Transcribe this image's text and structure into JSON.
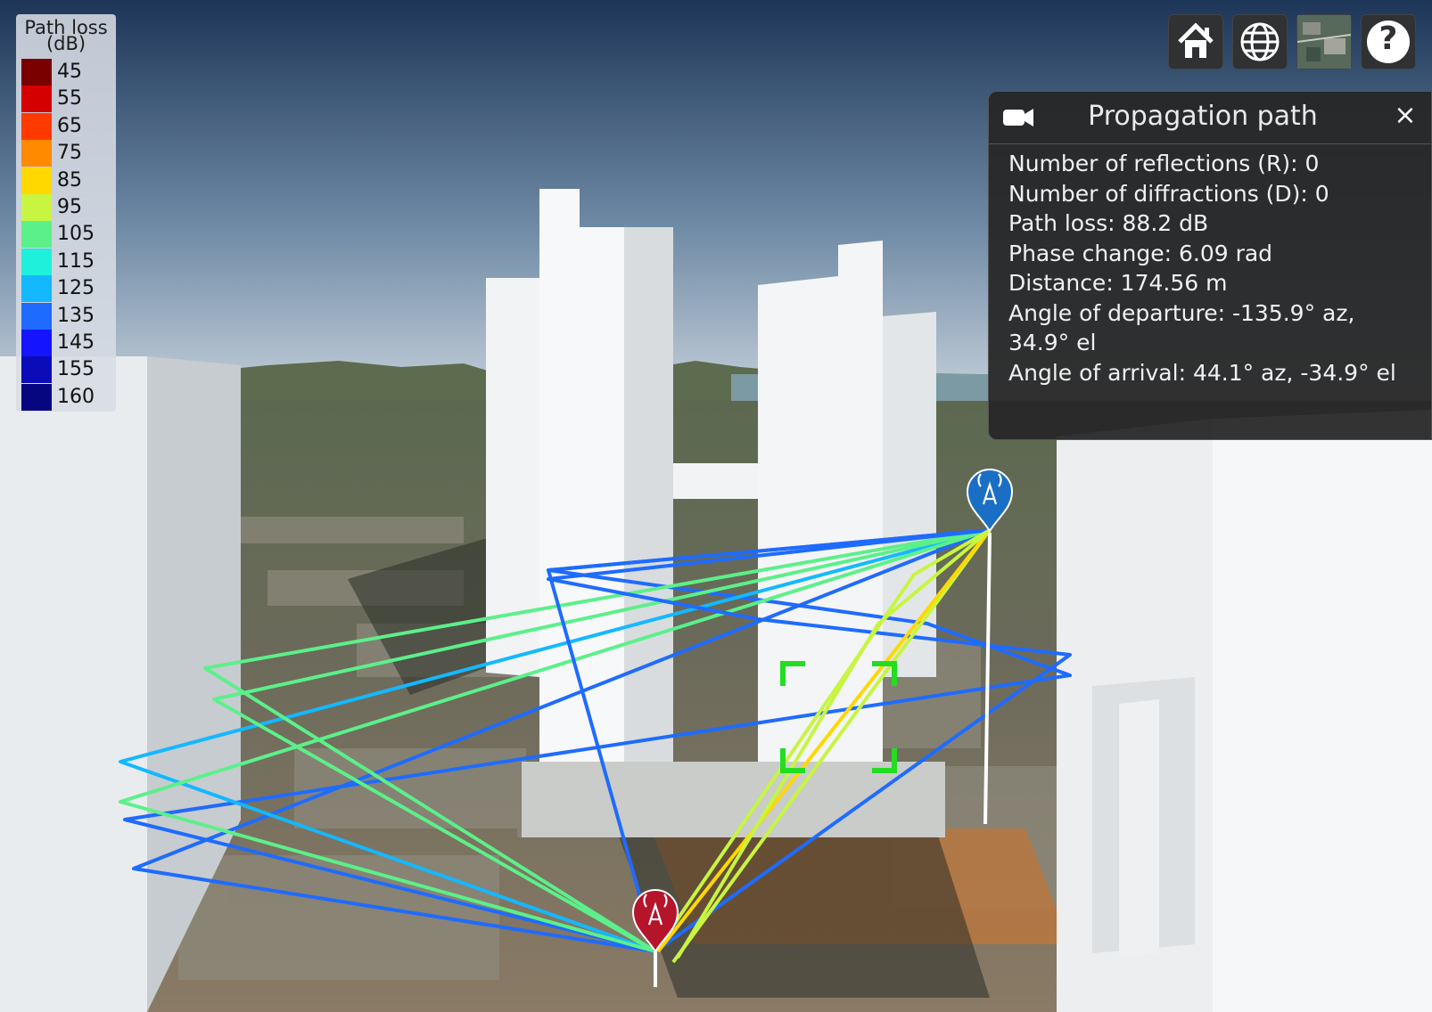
{
  "legend": {
    "title_line1": "Path loss",
    "title_line2": "(dB)",
    "entries": [
      {
        "label": "45",
        "color": "#7a0000"
      },
      {
        "label": "55",
        "color": "#d40000"
      },
      {
        "label": "65",
        "color": "#ff3a00"
      },
      {
        "label": "75",
        "color": "#ff8a00"
      },
      {
        "label": "85",
        "color": "#ffd800"
      },
      {
        "label": "95",
        "color": "#c7f542"
      },
      {
        "label": "105",
        "color": "#5cf08a"
      },
      {
        "label": "115",
        "color": "#1ff0dc"
      },
      {
        "label": "125",
        "color": "#14b8ff"
      },
      {
        "label": "135",
        "color": "#1f6bff"
      },
      {
        "label": "145",
        "color": "#1414ff"
      },
      {
        "label": "155",
        "color": "#0b0bb8"
      },
      {
        "label": "160",
        "color": "#060680"
      }
    ]
  },
  "toolbar": {
    "buttons": [
      {
        "name": "home-button",
        "icon": "home-icon"
      },
      {
        "name": "globe-button",
        "icon": "globe-icon"
      },
      {
        "name": "basemap-button",
        "icon": "satellite-map-icon"
      },
      {
        "name": "help-button",
        "icon": "help-icon"
      }
    ],
    "help_glyph": "?"
  },
  "panel": {
    "title": "Propagation path",
    "close_glyph": "×",
    "lines": [
      "Number of reflections (R): 0",
      "Number of diffractions (D): 0",
      "Path loss: 88.2 dB",
      "Phase change: 6.09 rad",
      "Distance: 174.56 m",
      "Angle of departure: -135.9° az,",
      "34.9° el",
      "Angle of arrival: 44.1° az, -34.9° el"
    ]
  },
  "scene": {
    "transmitter_icon": "antenna-tower-icon",
    "receiver_icon": "antenna-tower-icon",
    "transmitter_color": "#b5142a",
    "receiver_color": "#1a6fc4",
    "selection_color": "#22dd22"
  }
}
